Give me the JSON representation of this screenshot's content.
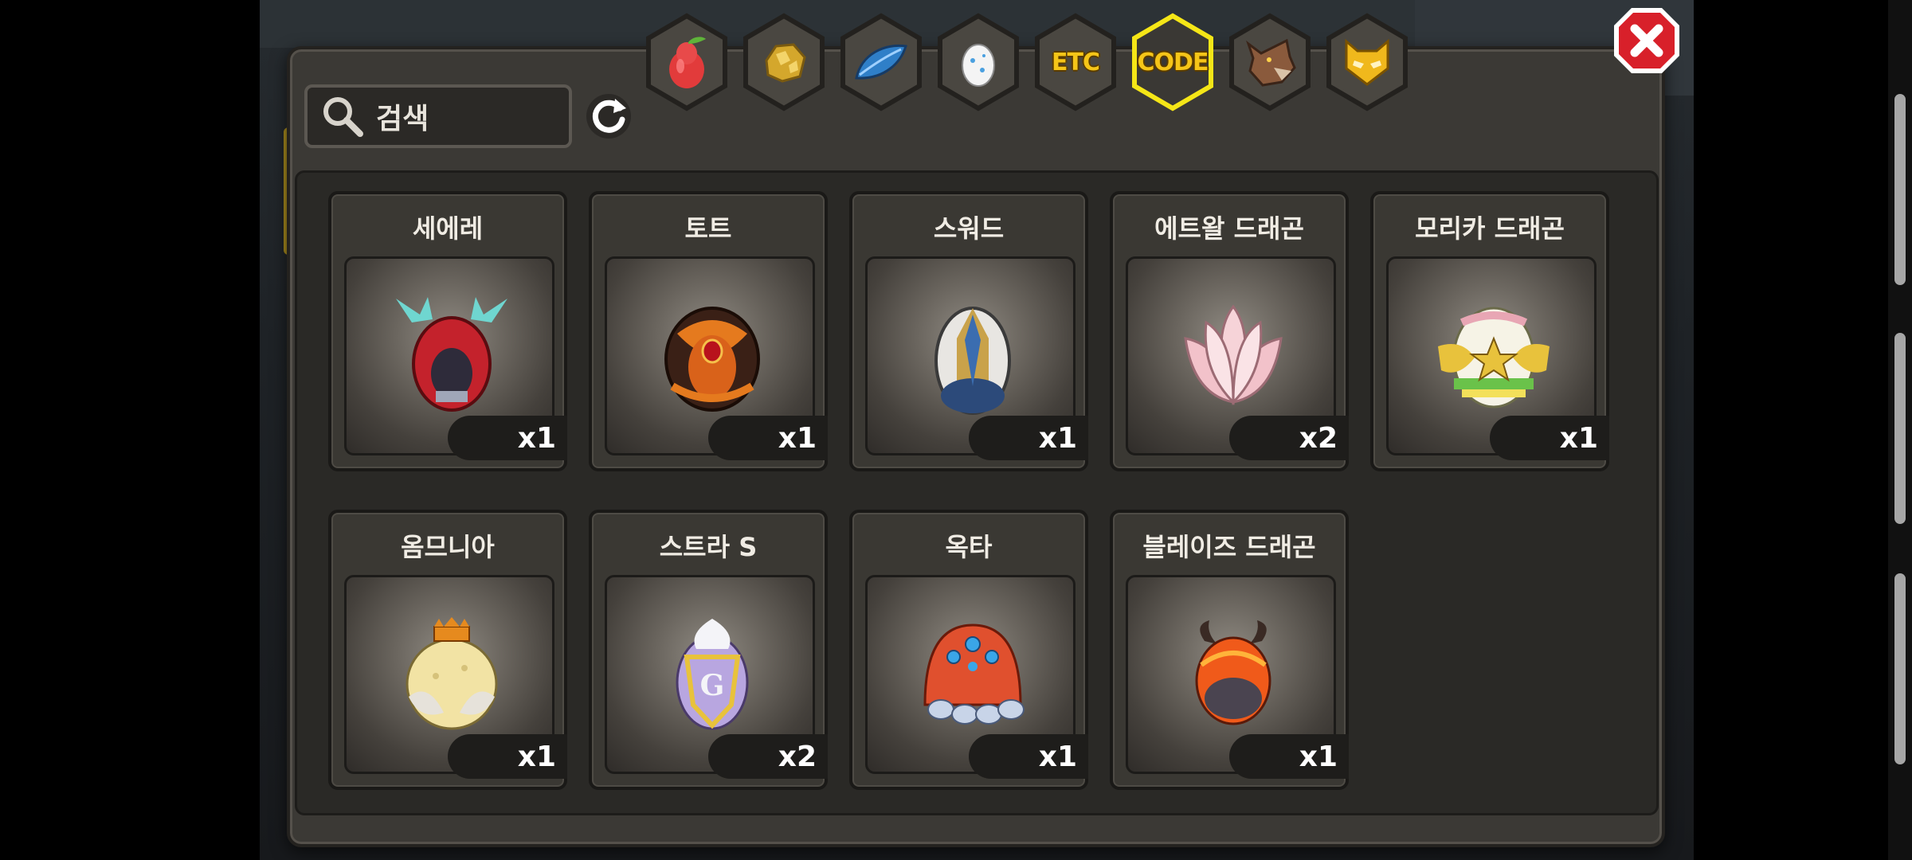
{
  "search": {
    "placeholder": "검색"
  },
  "tabs": [
    {
      "name": "tab-fruit",
      "icon": "red-pear-icon",
      "selected": false
    },
    {
      "name": "tab-gold",
      "icon": "gold-nugget-icon",
      "selected": false
    },
    {
      "name": "tab-feather",
      "icon": "blue-feather-icon",
      "selected": false
    },
    {
      "name": "tab-egg",
      "icon": "egg-icon",
      "selected": false
    },
    {
      "name": "tab-etc",
      "label": "ETC",
      "selected": false
    },
    {
      "name": "tab-code",
      "label": "CODE",
      "selected": true
    },
    {
      "name": "tab-wolf",
      "icon": "wolf-head-icon",
      "selected": false
    },
    {
      "name": "tab-mask",
      "icon": "yellow-mask-icon",
      "selected": false
    }
  ],
  "items": [
    {
      "name": "세에레",
      "qty": "x1",
      "icon": "red-hood-egg-icon"
    },
    {
      "name": "토트",
      "qty": "x1",
      "icon": "orange-shell-egg-icon"
    },
    {
      "name": "스워드",
      "qty": "x1",
      "icon": "armored-blue-egg-icon"
    },
    {
      "name": "에트왈 드래곤",
      "qty": "x2",
      "icon": "lotus-egg-icon"
    },
    {
      "name": "모리카 드래곤",
      "qty": "x1",
      "icon": "star-winged-egg-icon"
    },
    {
      "name": "옴므니아",
      "qty": "x1",
      "icon": "crowned-yellow-egg-icon"
    },
    {
      "name": "스트라 S",
      "qty": "x2",
      "icon": "purple-crest-egg-icon"
    },
    {
      "name": "옥타",
      "qty": "x1",
      "icon": "octopus-egg-icon"
    },
    {
      "name": "블레이즈 드래곤",
      "qty": "x1",
      "icon": "horned-fire-egg-icon"
    }
  ],
  "colors": {
    "tab_selected": "#f5e617",
    "panel": "#3b3935",
    "close": "#d8202a"
  }
}
